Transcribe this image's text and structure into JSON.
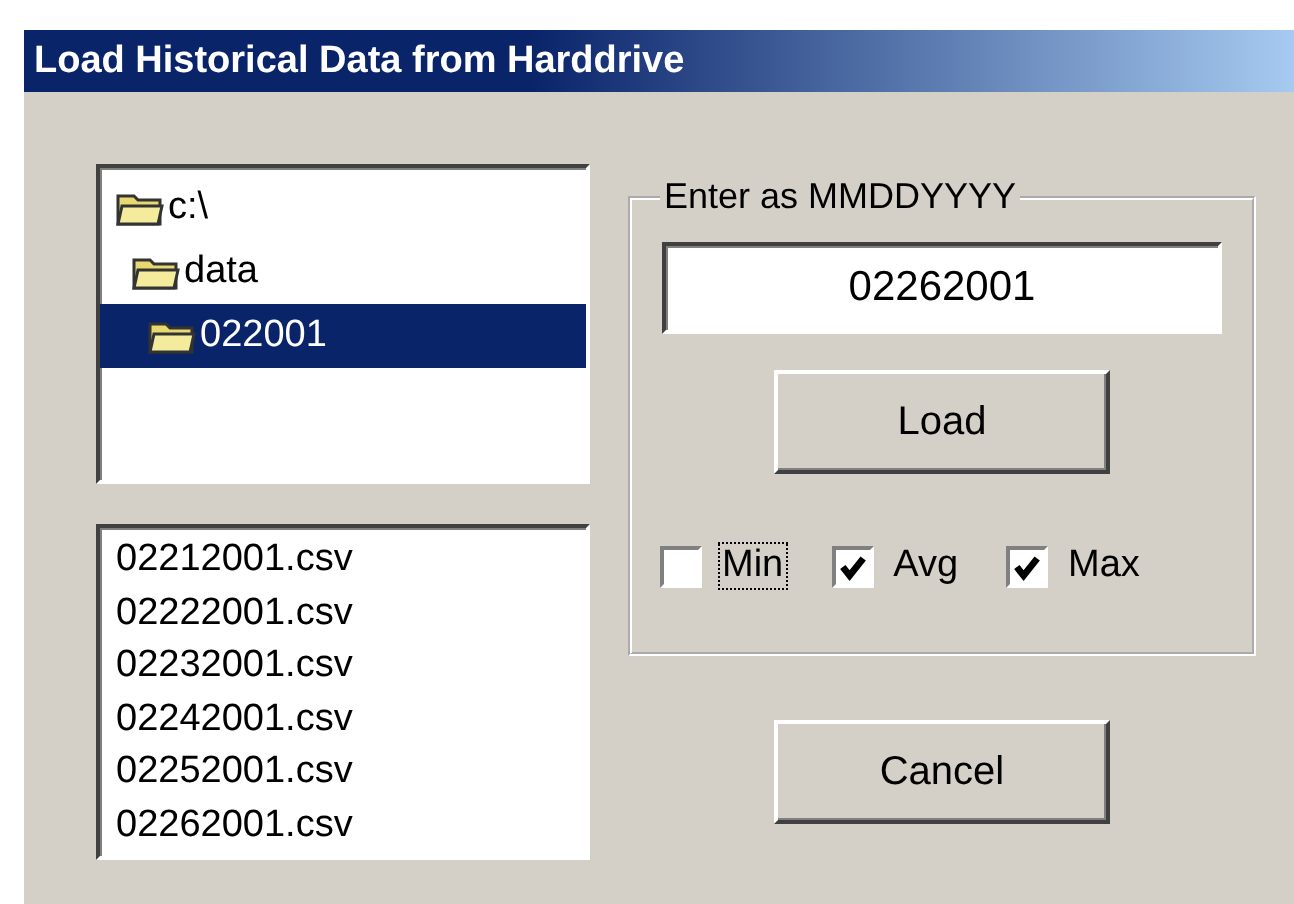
{
  "window": {
    "title": "Load Historical Data from Harddrive"
  },
  "folder_tree": [
    {
      "label": "c:\\",
      "selected": false,
      "children": [
        {
          "label": "data",
          "selected": false,
          "children": [
            {
              "label": "022001",
              "selected": true
            }
          ]
        }
      ]
    }
  ],
  "files": [
    "02212001.csv",
    "02222001.csv",
    "02232001.csv",
    "02242001.csv",
    "02252001.csv",
    "02262001.csv"
  ],
  "date_group": {
    "legend": "Enter as MMDDYYYY",
    "value": "02262001",
    "load_button": "Load",
    "checkboxes": [
      {
        "label": "Min",
        "checked": false,
        "focused": true
      },
      {
        "label": "Avg",
        "checked": true,
        "focused": false
      },
      {
        "label": "Max",
        "checked": true,
        "focused": false
      }
    ]
  },
  "cancel_button": "Cancel"
}
